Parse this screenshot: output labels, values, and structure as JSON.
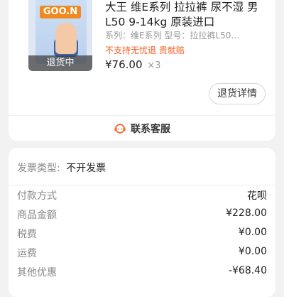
{
  "order": {
    "status_overlay": "退货中",
    "thumb_logo": "GOO.N",
    "title": "大王 维E系列 拉拉裤 尿不湿 男L50 9-14kg 原装进口",
    "spec": "系列：维E系列 型号：拉拉裤L50…",
    "warning": "不支持无忧退 贵就赔",
    "price": "¥76.00",
    "quantity": "×3",
    "refund_detail_label": "退货详情",
    "customer_service_label": "联系客服"
  },
  "invoice": {
    "label": "发票类型:",
    "value": "不开发票"
  },
  "fees": [
    {
      "label": "付款方式",
      "value": "花呗"
    },
    {
      "label": "商品金额",
      "value": "¥228.00"
    },
    {
      "label": "税费",
      "value": "¥0.00"
    },
    {
      "label": "运费",
      "value": "¥0.00"
    },
    {
      "label": "其他优惠",
      "value": "-¥68.40"
    }
  ],
  "colors": {
    "warning": "#f35c1f",
    "service_icon": "#f36a2a"
  }
}
